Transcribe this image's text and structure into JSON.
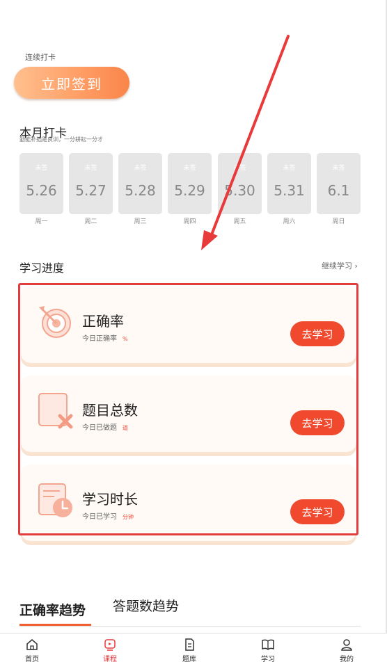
{
  "checkin": {
    "streak_label": "连续打卡",
    "button_label": "立即签到"
  },
  "month": {
    "title": "本月打卡",
    "subtitle": "勤能补拙是良训，一分耕耘一分才",
    "days": [
      {
        "status": "未签",
        "date": "5.26",
        "weekday": "周一"
      },
      {
        "status": "未签",
        "date": "5.27",
        "weekday": "周二"
      },
      {
        "status": "未签",
        "date": "5.28",
        "weekday": "周三"
      },
      {
        "status": "未签",
        "date": "5.29",
        "weekday": "周四"
      },
      {
        "status": "未签",
        "date": "5.30",
        "weekday": "周五"
      },
      {
        "status": "未签",
        "date": "5.31",
        "weekday": "周六"
      },
      {
        "status": "未签",
        "date": "6.1",
        "weekday": "周日"
      }
    ]
  },
  "progress": {
    "title": "学习进度",
    "continue_label": "继续学习 ›",
    "cards": [
      {
        "title": "正确率",
        "sub": "今日正确率",
        "unit": "%",
        "button": "去学习",
        "icon": "target-icon"
      },
      {
        "title": "题目总数",
        "sub": "今日已做题",
        "unit": "道",
        "button": "去学习",
        "icon": "question-count-icon"
      },
      {
        "title": "学习时长",
        "sub": "今日已学习",
        "unit": "分钟",
        "button": "去学习",
        "icon": "clock-icon"
      }
    ]
  },
  "trend_tabs": {
    "active": "正确率趋势",
    "inactive": "答题数趋势"
  },
  "bottom_nav": [
    {
      "label": "首页",
      "icon": "home-icon"
    },
    {
      "label": "课程",
      "icon": "course-icon"
    },
    {
      "label": "题库",
      "icon": "question-bank-icon"
    },
    {
      "label": "学习",
      "icon": "book-icon"
    },
    {
      "label": "我的",
      "icon": "profile-icon"
    }
  ],
  "colors": {
    "accent": "#f0492e",
    "highlight": "#e23d3d",
    "nav_active": "#e8393b",
    "checkin_gradient_start": "#ffc08e",
    "checkin_gradient_end": "#fa8549"
  }
}
